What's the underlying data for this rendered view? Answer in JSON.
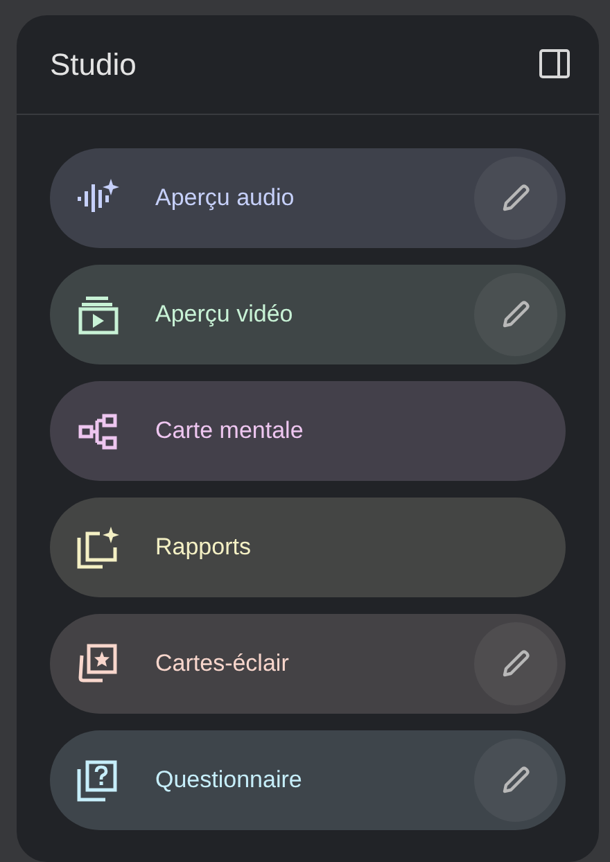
{
  "panel": {
    "title": "Studio"
  },
  "tools": [
    {
      "label": "Aperçu audio",
      "kind": "audio",
      "color": "#c6d0fa",
      "editable": true
    },
    {
      "label": "Aperçu vidéo",
      "kind": "video",
      "color": "#c8f2d6",
      "editable": true
    },
    {
      "label": "Carte mentale",
      "kind": "mindmap",
      "color": "#eec6f0",
      "editable": false
    },
    {
      "label": "Rapports",
      "kind": "report",
      "color": "#f4f0c4",
      "editable": false
    },
    {
      "label": "Cartes-éclair",
      "kind": "flashcard",
      "color": "#f8d6cc",
      "editable": true
    },
    {
      "label": "Questionnaire",
      "kind": "quiz",
      "color": "#c6eefa",
      "editable": true
    }
  ]
}
